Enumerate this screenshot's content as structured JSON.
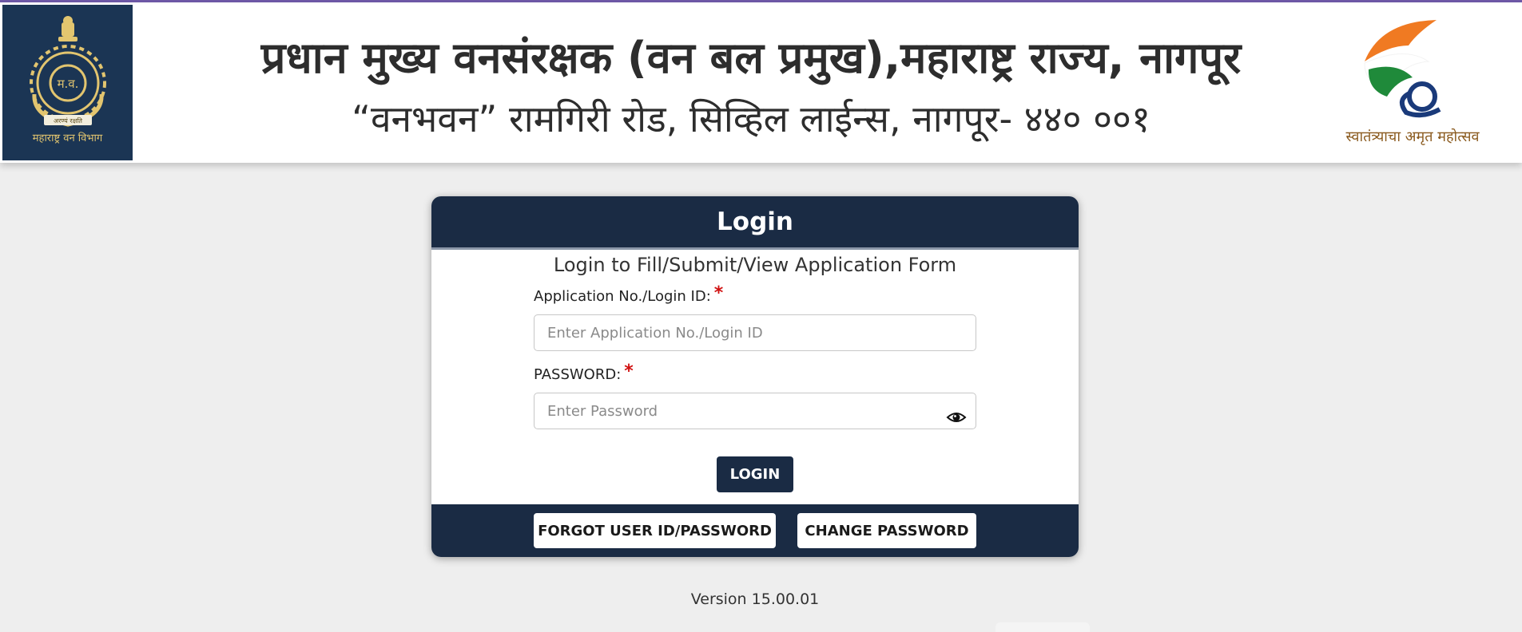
{
  "header": {
    "title": "प्रधान मुख्य वनसंरक्षक (वन बल प्रमुख),महाराष्ट्र राज्य, नागपूर",
    "subtitle": "“वनभवन” रामगिरी रोड, सिव्हिल लाईन्स, नागपूर- ४४० ००१",
    "emblem_inscription": "म.व.",
    "emblem_ribbon": "अरण्यं रक्षति",
    "emblem_caption": "महाराष्ट्र वन विभाग",
    "amrut_caption": "स्वातंत्र्याचा अमृत महोत्सव"
  },
  "login": {
    "title": "Login",
    "subtitle": "Login to Fill/Submit/View Application Form",
    "login_id_label": "Application No./Login ID:",
    "login_id_value": "",
    "login_id_placeholder": "Enter Application No./Login ID",
    "password_label": "PASSWORD:",
    "password_value": "",
    "password_placeholder": "Enter Password",
    "required_mark": "*",
    "login_button": "LOGIN",
    "forgot_button": "FORGOT USER ID/PASSWORD",
    "change_password_button": "CHANGE PASSWORD",
    "show_password_icon": "eye-icon"
  },
  "footer": {
    "version": "Version 15.00.01"
  },
  "colors": {
    "primary": "#1a2b44",
    "emblem_bg": "#1b3554",
    "emblem_gold": "#e2c56f",
    "required": "#d01010",
    "page_bg": "#eeeeee",
    "top_accent": "#6f5aa8"
  }
}
